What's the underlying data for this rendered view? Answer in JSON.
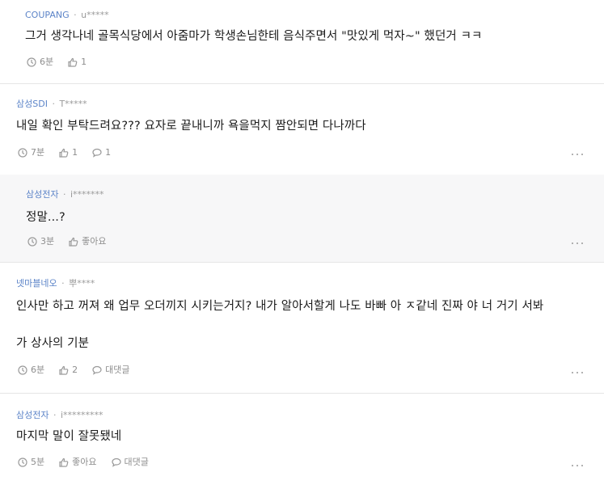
{
  "comments": [
    {
      "company": "COUPANG",
      "user": "u*****",
      "lines": [
        "그거 생각나네 골목식당에서 아줌마가 학생손님한테 음식주면서 \"맛있게 먹자~\" 했던거 ㅋㅋ"
      ],
      "time": "6분",
      "likes": "1",
      "replies": ""
    },
    {
      "company": "삼성SDI",
      "user": "T*****",
      "lines": [
        "내일 확인 부탁드려요??? 요자로 끝내니까 욕을먹지 짬안되면 다나까다"
      ],
      "time": "7분",
      "likes": "1",
      "replies": "1"
    },
    {
      "company": "삼성전자",
      "user": "i*******",
      "lines": [
        "정말...?"
      ],
      "time": "3분",
      "likes": "좋아요",
      "replies": ""
    },
    {
      "company": "넷마블네오",
      "user": "뿌****",
      "lines": [
        "인사만 하고 꺼져 왜 업무 오더끼지 시키는거지? 내가 알아서할게 나도 바빠 아 ㅈ같네 진짜 야 너 거기 서봐",
        "가 상사의 기분"
      ],
      "time": "6분",
      "likes": "2",
      "replies": "대댓글"
    },
    {
      "company": "삼성전자",
      "user": "i*********",
      "lines": [
        "마지막 말이 잘못됐네"
      ],
      "time": "5분",
      "likes": "좋아요",
      "replies": "대댓글"
    }
  ],
  "separator": "·",
  "icons": {
    "time": "clock-icon",
    "like": "thumbs-up-icon",
    "reply": "speech-bubble-icon",
    "more": "more-options-icon"
  },
  "colors": {
    "company": "#5c84c8",
    "meta": "#9a9a9a",
    "reply_bg": "#f7f7f8",
    "divider": "#e6e6e6"
  }
}
